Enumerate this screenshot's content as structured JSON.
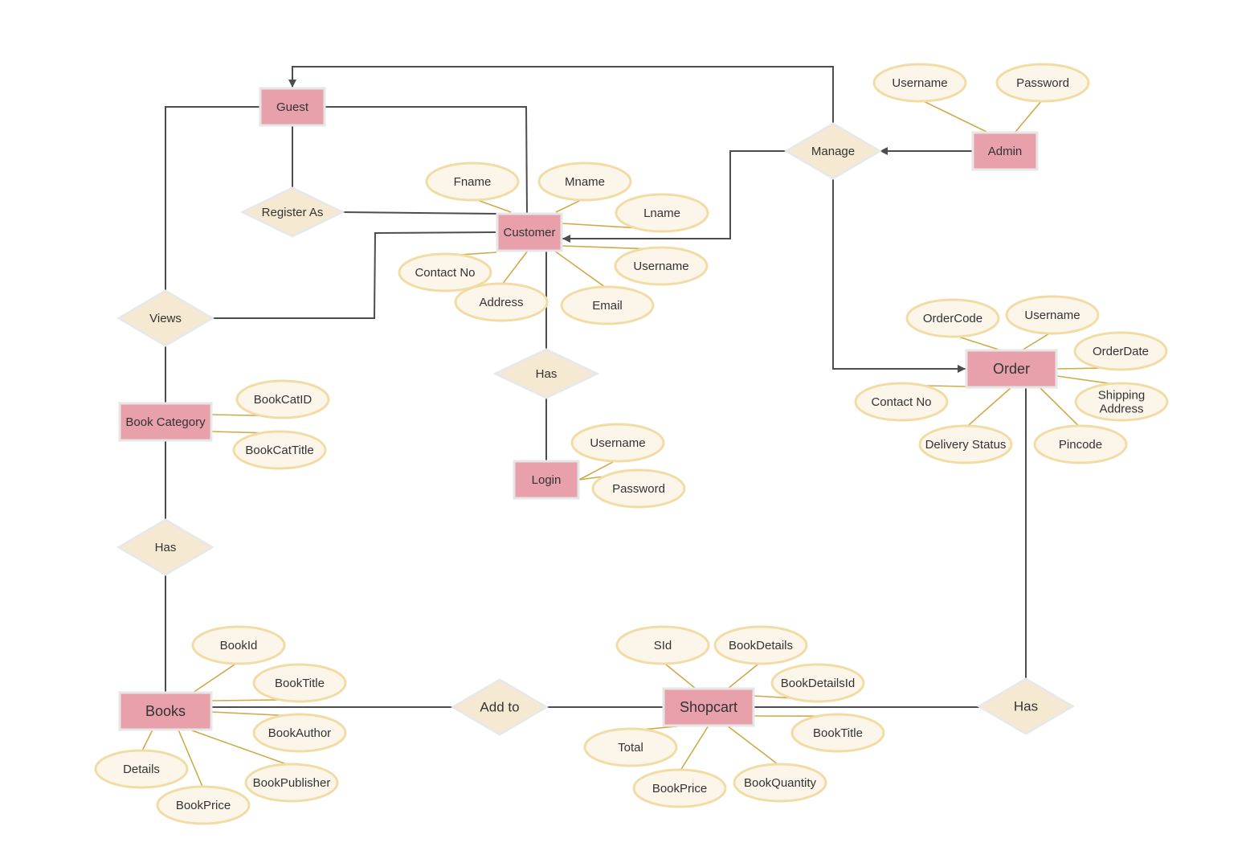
{
  "diagram": {
    "type": "Entity-Relationship Diagram",
    "colors": {
      "entity_fill": "#e8a0aa",
      "relationship_fill": "#f6e9d2",
      "attribute_fill": "#fcf6ea",
      "attribute_stroke": "#f2dca6",
      "attribute_link": "#cfaa4a",
      "connector": "#4d4d4d"
    },
    "entities": {
      "guest": "Guest",
      "customer": "Customer",
      "admin": "Admin",
      "order": "Order",
      "book_category": "Book Category",
      "login": "Login",
      "books": "Books",
      "shopcart": "Shopcart"
    },
    "relationships": {
      "register_as": "Register As",
      "manage": "Manage",
      "views": "Views",
      "customer_has_login": "Has",
      "category_has_books": "Has",
      "add_to": "Add to",
      "shopcart_has_order": "Has"
    },
    "attributes": {
      "customer": [
        "Fname",
        "Mname",
        "Lname",
        "Username",
        "Email",
        "Address",
        "Contact No"
      ],
      "admin": [
        "Username",
        "Password"
      ],
      "order": [
        "OrderCode",
        "Username",
        "OrderDate",
        "Shipping Address",
        "Pincode",
        "Delivery Status",
        "Contact No"
      ],
      "book_category": [
        "BookCatID",
        "BookCatTitle"
      ],
      "login": [
        "Username",
        "Password"
      ],
      "books": [
        "BookId",
        "BookTitle",
        "BookAuthor",
        "BookPublisher",
        "BookPrice",
        "Details"
      ],
      "shopcart": [
        "SId",
        "BookDetails",
        "BookDetailsId",
        "BookTitle",
        "BookQuantity",
        "BookPrice",
        "Total"
      ]
    }
  }
}
